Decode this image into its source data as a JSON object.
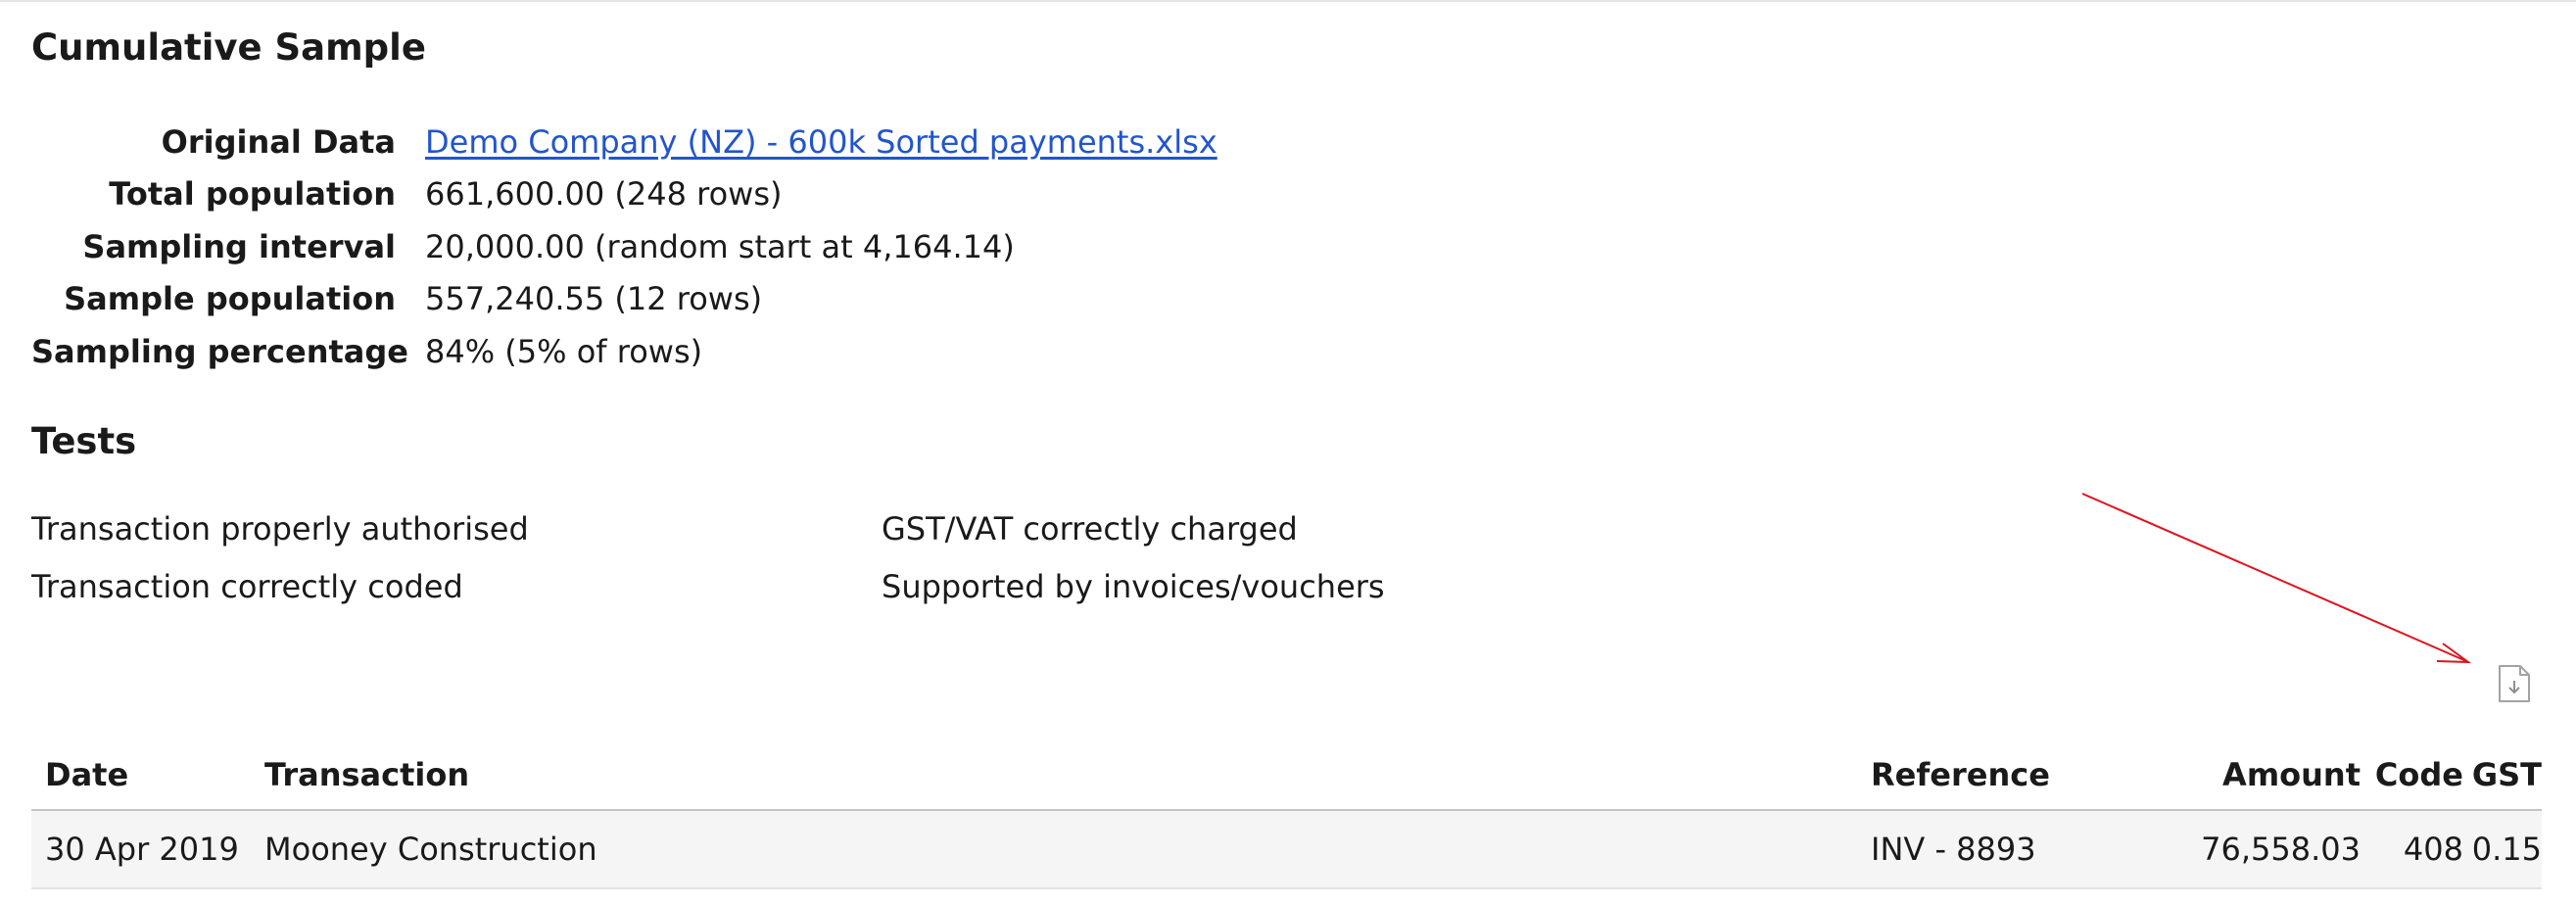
{
  "cumulative_title": "Cumulative Sample",
  "summary": [
    {
      "label": "Original Data",
      "value": "Demo Company (NZ) - 600k Sorted payments.xlsx"
    },
    {
      "label": "Total population",
      "value": "661,600.00 (248 rows)"
    },
    {
      "label": "Sampling interval",
      "value": "20,000.00 (random start at 4,164.14)"
    },
    {
      "label": "Sample population",
      "value": "557,240.55 (12 rows)"
    },
    {
      "label": "Sampling percentage",
      "value": "84% (5% of rows)"
    }
  ],
  "tests_title": "Tests",
  "tests": [
    "Transaction properly authorised",
    "GST/VAT correctly charged",
    "Transaction correctly coded",
    "Supported by invoices/vouchers"
  ],
  "table": {
    "headers": {
      "date": "Date",
      "transaction": "Transaction",
      "reference": "Reference",
      "amount": "Amount",
      "code": "Code",
      "gst": "GST"
    },
    "rows": [
      {
        "date": "30 Apr 2019",
        "transaction": "Mooney Construction",
        "reference": "INV - 8893",
        "amount": "76,558.03",
        "code": "408",
        "gst": "0.15"
      }
    ]
  },
  "icons": {
    "download": "document-download-icon"
  },
  "colors": {
    "link": "#2255cc",
    "annotation_arrow": "#e0141e",
    "row_background": "#f5f5f5"
  }
}
